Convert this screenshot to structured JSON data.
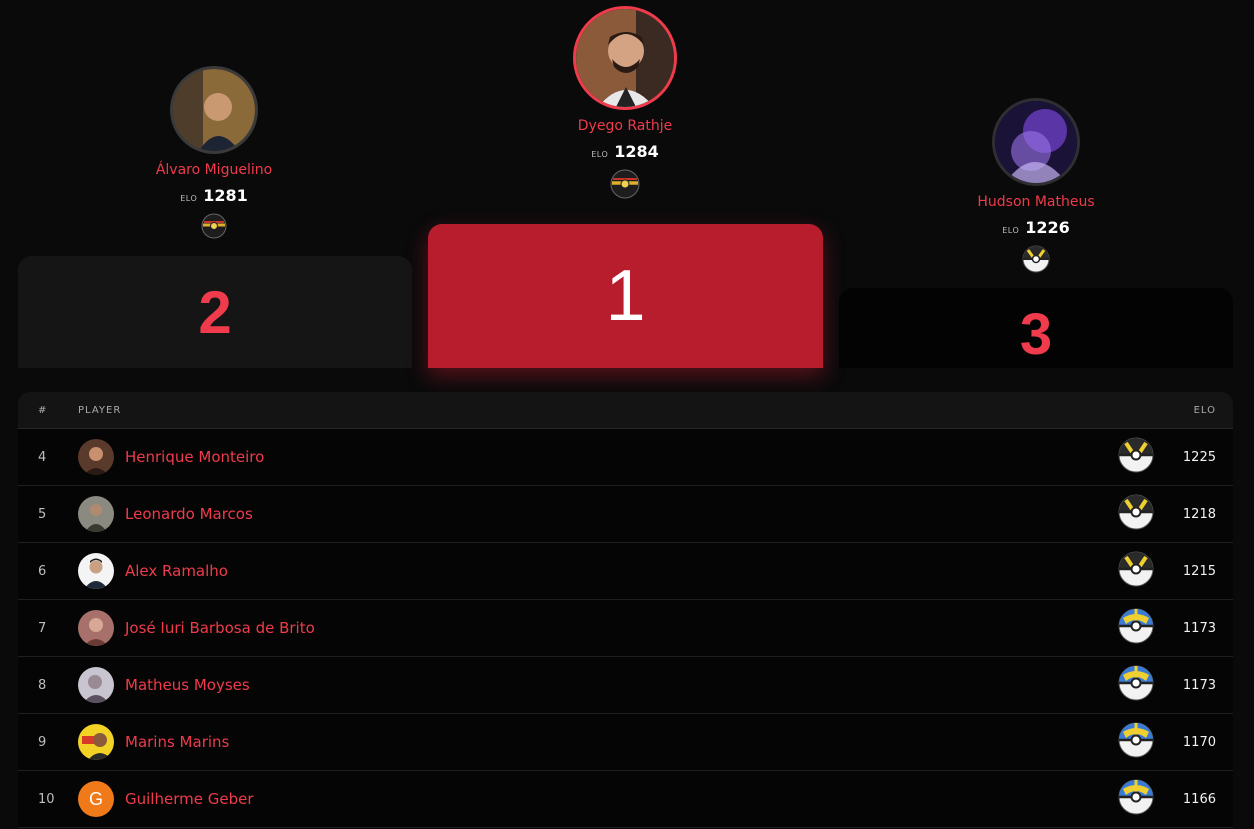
{
  "podium": {
    "first": {
      "rank": "1",
      "name": "Dyego Rathje",
      "elo_label": "ELO",
      "elo": "1284",
      "ball": "luxury-ball-icon"
    },
    "second": {
      "rank": "2",
      "name": "Álvaro Miguelino",
      "elo_label": "ELO",
      "elo": "1281",
      "ball": "luxury-ball-icon"
    },
    "third": {
      "rank": "3",
      "name": "Hudson Matheus",
      "elo_label": "ELO",
      "elo": "1226",
      "ball": "ultra-ball-icon"
    }
  },
  "table": {
    "headers": {
      "rank": "#",
      "player": "PLAYER",
      "elo": "ELO"
    },
    "rows": [
      {
        "rank": "4",
        "name": "Henrique Monteiro",
        "elo": "1225",
        "ball": "ultra-ball-icon"
      },
      {
        "rank": "5",
        "name": "Leonardo Marcos",
        "elo": "1218",
        "ball": "ultra-ball-icon"
      },
      {
        "rank": "6",
        "name": "Alex Ramalho",
        "elo": "1215",
        "ball": "ultra-ball-icon"
      },
      {
        "rank": "7",
        "name": "José Iuri Barbosa de Brito",
        "elo": "1173",
        "ball": "quick-ball-icon"
      },
      {
        "rank": "8",
        "name": "Matheus Moyses",
        "elo": "1173",
        "ball": "quick-ball-icon"
      },
      {
        "rank": "9",
        "name": "Marins Marins",
        "elo": "1170",
        "ball": "quick-ball-icon"
      },
      {
        "rank": "10",
        "name": "Guilherme Geber",
        "elo": "1166",
        "ball": "quick-ball-icon",
        "avatar_letter": "G"
      }
    ]
  },
  "colors": {
    "accent": "#ef3b4b",
    "first_block": "#b81d2e",
    "background": "#0a0a0b"
  }
}
